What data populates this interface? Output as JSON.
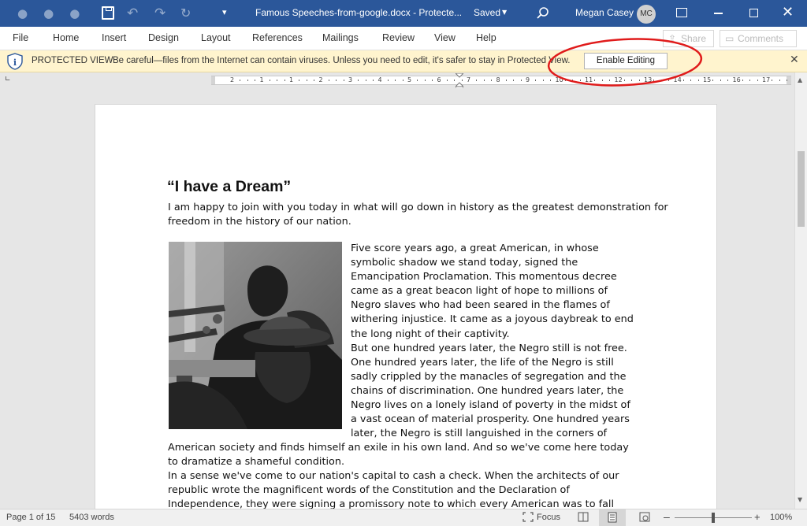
{
  "titlebar": {
    "doc_title": "Famous Speeches-from-google.docx  -  Protecte...",
    "save_state": "Saved",
    "user_name": "Megan Casey",
    "user_initials": "MC",
    "qat_icons": [
      "autosave-toggle",
      "save-icon",
      "undo-icon",
      "redo-icon",
      "repeat-icon"
    ],
    "window_controls": [
      "ribbon-display-options-icon",
      "minimize-icon",
      "maximize-icon",
      "close-icon"
    ]
  },
  "ribbon": {
    "tabs": [
      "File",
      "Home",
      "Insert",
      "Design",
      "Layout",
      "References",
      "Mailings",
      "Review",
      "View",
      "Help"
    ],
    "share_label": "Share",
    "comments_label": "Comments"
  },
  "protected_view": {
    "label": "PROTECTED VIEW",
    "message": "Be careful—files from the Internet can contain viruses. Unless you need to edit, it's safer to stay in Protected View.",
    "button": "Enable Editing",
    "annotation_color": "#e01b1b"
  },
  "ruler": {
    "numbers": [
      "2",
      "1",
      "1",
      "2",
      "3",
      "4",
      "5",
      "6",
      "7",
      "8",
      "9",
      "10",
      "11",
      "12",
      "13",
      "14",
      "15",
      "16",
      "17"
    ]
  },
  "document": {
    "heading": "“I have a Dream”",
    "intro_lines": [
      "I am happy to join with you today in what will go down in history as the greatest demonstration for",
      "freedom in the history of our nation."
    ],
    "wrapped_lines": [
      "Five score years ago, a great American, in whose",
      "symbolic shadow we stand today, signed the",
      "Emancipation Proclamation. This momentous decree",
      "came as a great beacon light of hope to millions of",
      "Negro slaves who had been seared in the flames of",
      "withering injustice. It came as a joyous daybreak to end",
      "the long night of their captivity.",
      "But one hundred years later, the Negro still is not free.",
      "One hundred years later, the life of the Negro is still",
      "sadly crippled by the manacles of segregation and the",
      "chains of discrimination. One hundred years later, the",
      "Negro lives on a lonely island of poverty in the midst of",
      "a vast ocean of material prosperity. One hundred years",
      "later, the Negro is still languished in the corners of"
    ],
    "full_lines": [
      "American society and finds himself an exile in his own land. And so we've come here today",
      "to dramatize a shameful condition.",
      "In a sense we've come to our nation's capital to cash a check. When the architects of our",
      "republic wrote the magnificent words of the Constitution and the Declaration of",
      "Independence, they were signing a promissory note to which every American was to fall"
    ],
    "photo_icon": "speaker-at-microphones-photo"
  },
  "statusbar": {
    "page": "Page 1 of 15",
    "words": "5403 words",
    "focus": "Focus",
    "zoom_minus": "–",
    "zoom_plus": "+",
    "zoom": "100%",
    "zoom_level": 1.0
  },
  "colors": {
    "titlebar": "#2b579a",
    "protected_bar": "#fff4ce",
    "workspace": "#e6e6e6"
  }
}
